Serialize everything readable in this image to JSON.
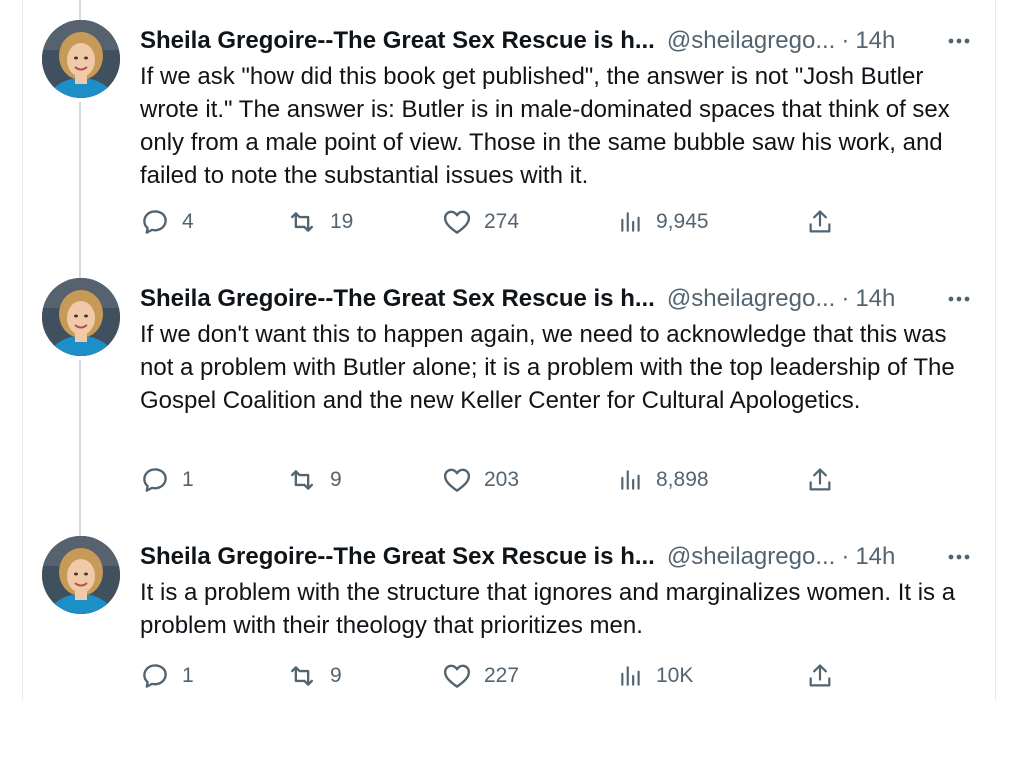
{
  "tweets": [
    {
      "author_name": "Sheila Gregoire--The Great Sex Rescue is h...",
      "handle": "@sheilagrego...",
      "separator": "·",
      "time": "14h",
      "text": "If we ask \"how did this book get published\", the answer is not \"Josh Butler wrote it.\" The answer is: Butler is in male-dominated spaces that think of sex only from a male point of view. Those in the same bubble saw his work, and failed to note the substantial issues with it.",
      "replies": "4",
      "retweets": "19",
      "likes": "274",
      "views": "9,945"
    },
    {
      "author_name": "Sheila Gregoire--The Great Sex Rescue is h...",
      "handle": "@sheilagrego...",
      "separator": "·",
      "time": "14h",
      "text": "If we don't want this to happen again, we need to acknowledge that this was not a problem with Butler alone; it is a problem with the top leadership of The Gospel Coalition and the new Keller Center for Cultural Apologetics.",
      "replies": "1",
      "retweets": "9",
      "likes": "203",
      "views": "8,898"
    },
    {
      "author_name": "Sheila Gregoire--The Great Sex Rescue is h...",
      "handle": "@sheilagrego...",
      "separator": "·",
      "time": "14h",
      "text": "It is a problem with the structure that ignores and marginalizes women. It is a problem with their theology that prioritizes men.",
      "replies": "1",
      "retweets": "9",
      "likes": "227",
      "views": "10K"
    }
  ],
  "icons": {
    "more": "more-horizontal-icon",
    "reply": "reply-icon",
    "retweet": "retweet-icon",
    "like": "heart-icon",
    "views": "views-chart-icon",
    "share": "share-icon"
  },
  "colors": {
    "text": "#0f1419",
    "secondary": "#536471",
    "thread_line": "#cfd9de",
    "avatar_shirt": "#1c8fc8"
  }
}
